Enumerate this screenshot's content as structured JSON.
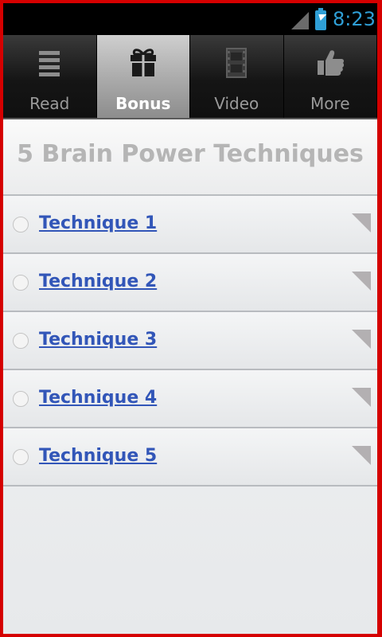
{
  "status_bar": {
    "time": "8:23"
  },
  "tabs": [
    {
      "label": "Read",
      "icon": "menu-lines-icon",
      "active": false
    },
    {
      "label": "Bonus",
      "icon": "gift-icon",
      "active": true
    },
    {
      "label": "Video",
      "icon": "film-strip-icon",
      "active": false
    },
    {
      "label": "More",
      "icon": "thumbs-up-icon",
      "active": false
    }
  ],
  "header": {
    "title": "5 Brain Power Techniques"
  },
  "list": {
    "items": [
      {
        "label": "Technique 1"
      },
      {
        "label": "Technique 2"
      },
      {
        "label": "Technique 3"
      },
      {
        "label": "Technique 4"
      },
      {
        "label": "Technique 5"
      }
    ]
  },
  "colors": {
    "frame": "#d50000",
    "accent_blue": "#2f9fd6",
    "link": "#3256b8",
    "title_gray": "#b5b5b5"
  }
}
